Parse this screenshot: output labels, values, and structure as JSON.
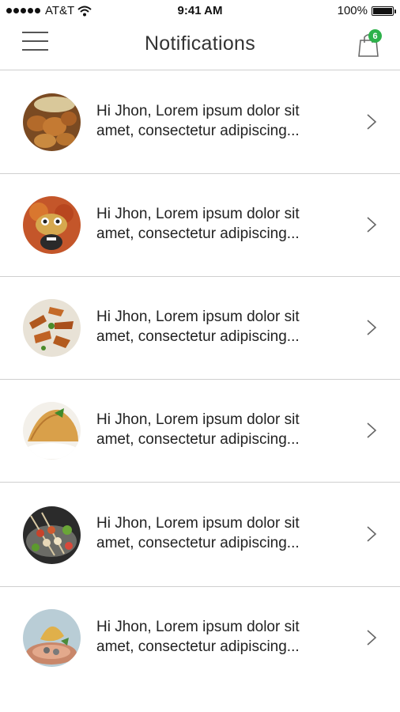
{
  "status_bar": {
    "carrier": "AT&T",
    "time": "9:41 AM",
    "battery": "100%"
  },
  "nav": {
    "title": "Notifications",
    "cart_count": "6"
  },
  "notifications": [
    {
      "line1": "Hi Jhon, Lorem ipsum dolor sit",
      "line2": "amet, consectetur adipiscing...",
      "thumb_icon": "fried-chicken-icon"
    },
    {
      "line1": "Hi Jhon, Lorem ipsum dolor sit",
      "line2": "amet, consectetur adipiscing...",
      "thumb_icon": "noodle-face-icon"
    },
    {
      "line1": "Hi Jhon, Lorem ipsum dolor sit",
      "line2": "amet, consectetur adipiscing...",
      "thumb_icon": "potato-wedges-icon"
    },
    {
      "line1": "Hi Jhon, Lorem ipsum dolor sit",
      "line2": "amet, consectetur adipiscing...",
      "thumb_icon": "samosa-icon"
    },
    {
      "line1": "Hi Jhon, Lorem ipsum dolor sit",
      "line2": "amet, consectetur adipiscing...",
      "thumb_icon": "kebab-skewers-icon"
    },
    {
      "line1": "Hi Jhon, Lorem ipsum dolor sit",
      "line2": "amet, consectetur adipiscing...",
      "thumb_icon": "seafood-plate-icon"
    }
  ],
  "colors": {
    "badge": "#2db14a",
    "divider": "#cfcfcf",
    "text": "#222222"
  }
}
